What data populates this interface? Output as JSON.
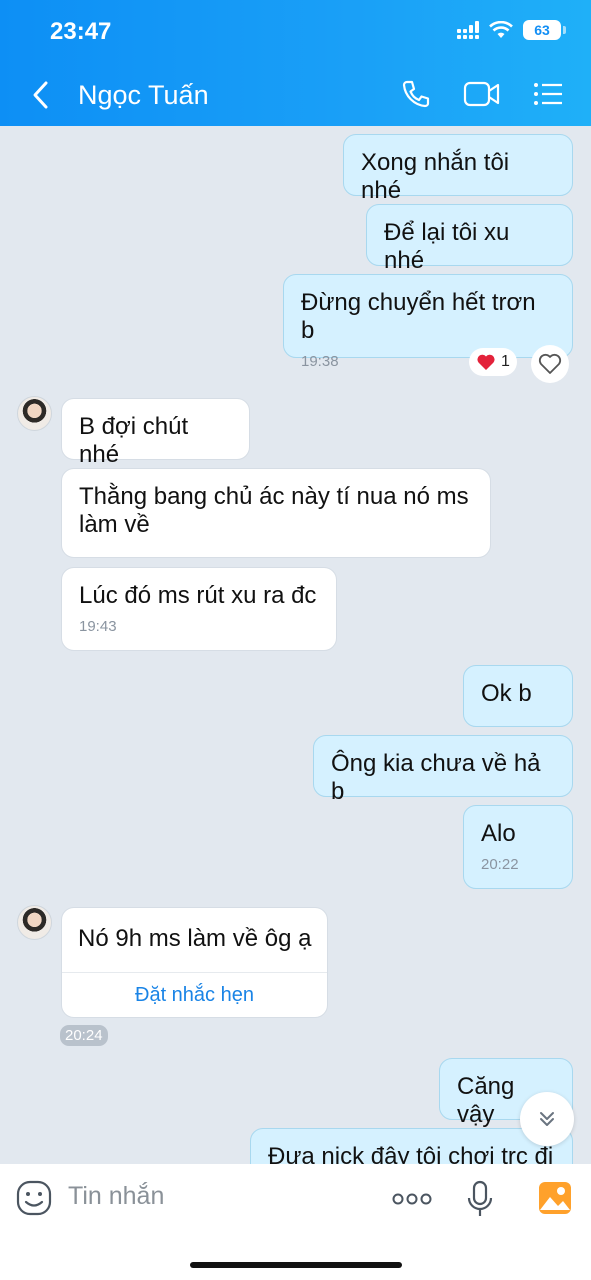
{
  "status_bar": {
    "time": "23:47",
    "battery": "63"
  },
  "header": {
    "contact_name": "Ngọc Tuấn"
  },
  "messages": [
    {
      "dir": "out",
      "text": "Xong nhắn tôi nhé"
    },
    {
      "dir": "out",
      "text": "Để lại tôi xu nhé"
    },
    {
      "dir": "out",
      "text": "Đừng chuyển hết trơn b",
      "time": "19:38",
      "reaction_count": "1"
    },
    {
      "dir": "in",
      "text": "B đợi chút nhé"
    },
    {
      "dir": "in",
      "text": "Thằng bang chủ ác này tí nua nó ms làm về"
    },
    {
      "dir": "in",
      "text": "Lúc đó ms rút xu ra đc",
      "time": "19:43"
    },
    {
      "dir": "out",
      "text": "Ok b"
    },
    {
      "dir": "out",
      "text": "Ông kia chưa về hả b"
    },
    {
      "dir": "out",
      "text": "Alo",
      "time": "20:22"
    },
    {
      "dir": "in",
      "text": "Nó 9h ms làm về ôg ạ",
      "action": "Đặt nhắc hẹn",
      "time": "20:24"
    },
    {
      "dir": "out",
      "text": "Căng vậy"
    },
    {
      "dir": "out",
      "text": "Đưa nick đây tôi chơi trc đi"
    }
  ],
  "composer": {
    "placeholder": "Tin nhắn"
  },
  "colors": {
    "header": "#1aa0f7",
    "outgoing_bubble": "#d5f1ff",
    "incoming_bubble": "#ffffff",
    "link": "#1a84e6",
    "background": "#e2e8ef"
  }
}
